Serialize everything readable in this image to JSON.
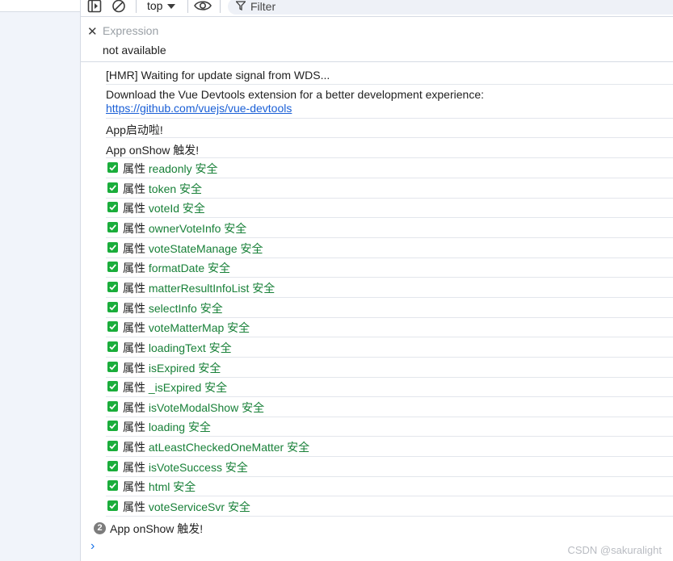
{
  "toolbar": {
    "context": "top",
    "filter_placeholder": "Filter"
  },
  "expression": {
    "placeholder": "Expression",
    "value": "not available"
  },
  "logs": {
    "hmr": "[HMR] Waiting for update signal from WDS...",
    "devtools_text": "Download the Vue Devtools extension for a better development experience:",
    "devtools_link": "https://github.com/vuejs/vue-devtools",
    "app_start": "App启动啦!",
    "app_onshow": "App onShow 触发!"
  },
  "property_prefix": "属性",
  "property_suffix": "安全",
  "properties": [
    "readonly",
    "token",
    "voteId",
    "ownerVoteInfo",
    "voteStateManage",
    "formatDate",
    "matterResultInfoList",
    "selectInfo",
    "voteMatterMap",
    "loadingText",
    "isExpired",
    "_isExpired",
    "isVoteModalShow",
    "loading",
    "atLeastCheckedOneMatter",
    "isVoteSuccess",
    "html",
    "voteServiceSvr"
  ],
  "repeat": {
    "count": "2",
    "text": "App onShow 触发!"
  },
  "prompt_symbol": "›",
  "watermark": "CSDN @sakuralight",
  "colors": {
    "check_green": "#1aad3b",
    "property_green": "#188038",
    "link_blue": "#1a5fd6"
  }
}
